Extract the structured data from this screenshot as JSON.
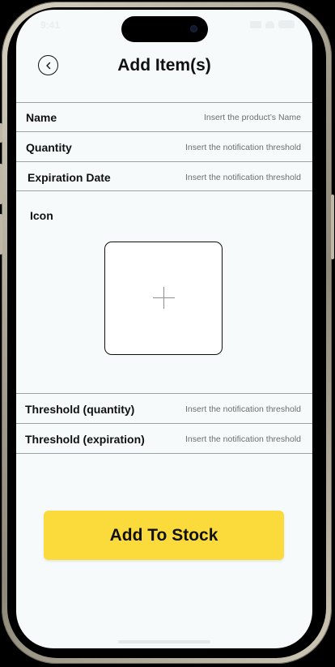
{
  "status_bar": {
    "time": "9:41"
  },
  "header": {
    "title": "Add Item(s)",
    "back_icon": "chevron-left-icon"
  },
  "form": {
    "name": {
      "label": "Name",
      "placeholder": "Insert the product’s Name",
      "value": ""
    },
    "quantity": {
      "label": "Quantity",
      "placeholder": "Insert the notification threshold",
      "value": ""
    },
    "expiration_date": {
      "label": "Expiration Date",
      "placeholder": "Insert the notification threshold",
      "value": ""
    },
    "icon": {
      "label": "Icon",
      "picker_icon": "plus-icon"
    },
    "threshold_quantity": {
      "label": "Threshold (quantity)",
      "placeholder": "Insert the notification threshold",
      "value": ""
    },
    "threshold_expiration": {
      "label": "Threshold (expiration)",
      "placeholder": "Insert the notification threshold",
      "value": ""
    }
  },
  "actions": {
    "add_to_stock_label": "Add To Stock"
  },
  "colors": {
    "screen_background": "#f6fafb",
    "accent_button": "#fbda3c",
    "text": "#111111",
    "divider": "#9aa4a8"
  }
}
